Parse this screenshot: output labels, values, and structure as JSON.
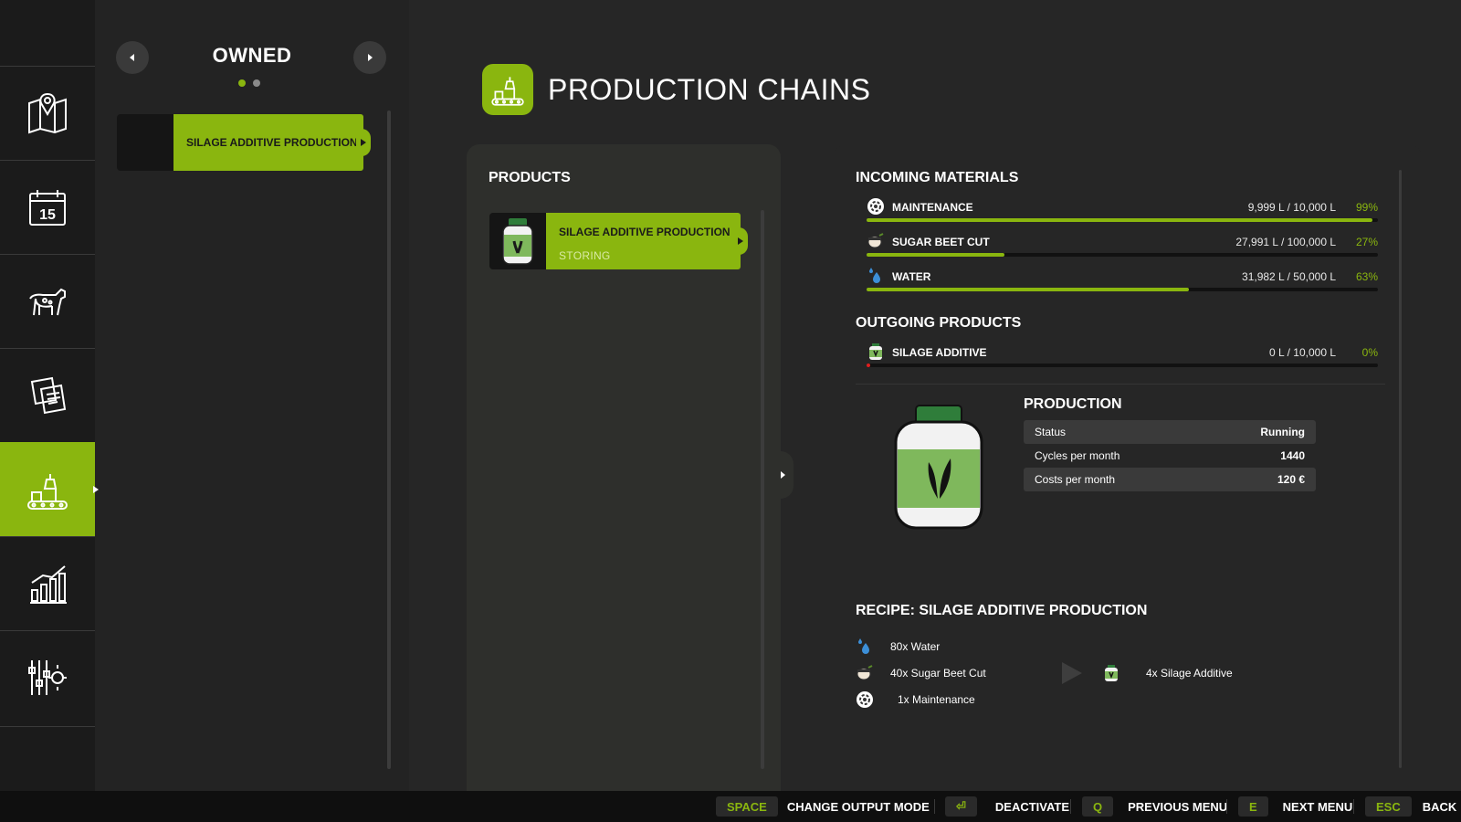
{
  "colors": {
    "accent": "#8ab60f",
    "panel": "#2e2f2c",
    "background": "#262626",
    "warning": "#e01e1e"
  },
  "nav": {
    "items": [
      {
        "icon": "map-icon"
      },
      {
        "icon": "calendar-icon",
        "label": "15"
      },
      {
        "icon": "animals-icon"
      },
      {
        "icon": "contracts-icon"
      },
      {
        "icon": "production-icon",
        "active": true
      },
      {
        "icon": "statistics-icon"
      },
      {
        "icon": "settings-icon"
      }
    ]
  },
  "owned": {
    "title": "OWNED",
    "page_indicator": {
      "pages": 2,
      "current": 1
    },
    "items": [
      {
        "label": "SILAGE ADDITIVE PRODUCTION"
      }
    ]
  },
  "header": {
    "title": "PRODUCTION CHAINS",
    "icon": "production-icon"
  },
  "products": {
    "title": "PRODUCTS",
    "items": [
      {
        "label": "SILAGE ADDITIVE PRODUCTION",
        "status": "STORING",
        "icon": "silage-additive-jar-icon"
      }
    ]
  },
  "incoming": {
    "title": "INCOMING MATERIALS",
    "items": [
      {
        "name": "MAINTENANCE",
        "amount": "9,999 L / 10,000 L",
        "percent_label": "99%",
        "fill": 0.99,
        "icon": "maintenance-icon"
      },
      {
        "name": "SUGAR BEET CUT",
        "amount": "27,991 L / 100,000 L",
        "percent_label": "27%",
        "fill": 0.27,
        "icon": "sugar-beet-cut-icon"
      },
      {
        "name": "WATER",
        "amount": "31,982 L / 50,000 L",
        "percent_label": "63%",
        "fill": 0.63,
        "icon": "water-drop-icon"
      }
    ]
  },
  "outgoing": {
    "title": "OUTGOING PRODUCTS",
    "items": [
      {
        "name": "SILAGE ADDITIVE",
        "amount": "0 L / 10,000 L",
        "percent_label": "0%",
        "fill": 0.0,
        "icon": "silage-additive-icon"
      }
    ]
  },
  "production": {
    "title": "PRODUCTION",
    "stats": [
      {
        "label": "Status",
        "value": "Running"
      },
      {
        "label": "Cycles per month",
        "value": "1440"
      },
      {
        "label": "Costs per month",
        "value": "120 €"
      }
    ]
  },
  "recipe": {
    "title": "RECIPE: SILAGE ADDITIVE PRODUCTION",
    "inputs": [
      {
        "text": "80x Water",
        "icon": "water-drop-icon"
      },
      {
        "text": "40x Sugar Beet Cut",
        "icon": "sugar-beet-cut-icon"
      },
      {
        "text": "1x Maintenance",
        "icon": "maintenance-icon"
      }
    ],
    "outputs": [
      {
        "text": "4x Silage Additive",
        "icon": "silage-additive-icon"
      }
    ]
  },
  "footer": {
    "hints": [
      {
        "key": "SPACE",
        "label": "CHANGE OUTPUT MODE"
      },
      {
        "key": "⏎",
        "label": "DEACTIVATE"
      },
      {
        "key": "Q",
        "label": "PREVIOUS MENU"
      },
      {
        "key": "E",
        "label": "NEXT MENU"
      },
      {
        "key": "ESC",
        "label": "BACK"
      }
    ]
  }
}
